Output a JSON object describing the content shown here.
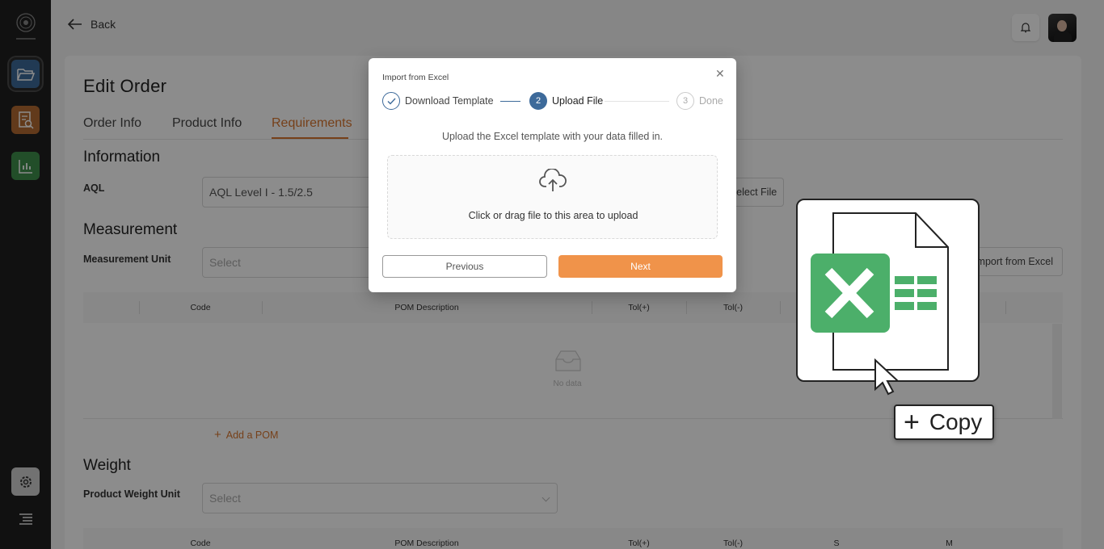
{
  "header": {
    "back_label": "Back"
  },
  "page": {
    "title": "Edit Order",
    "tabs": [
      {
        "label": "Order Info"
      },
      {
        "label": "Product Info"
      },
      {
        "label": "Requirements",
        "active": true
      }
    ]
  },
  "information": {
    "section_title": "Information",
    "aql_label": "AQL",
    "aql_value": "AQL Level I - 1.5/2.5",
    "select_file_label": "Select File"
  },
  "measurement": {
    "section_title": "Measurement",
    "unit_label": "Measurement Unit",
    "unit_placeholder": "Select",
    "import_button": "Import from Excel",
    "columns": [
      "Code",
      "POM Description",
      "Tol(+)",
      "Tol(-)"
    ],
    "empty_text": "No data",
    "add_pom": "Add a POM"
  },
  "weight": {
    "section_title": "Weight",
    "unit_label": "Product Weight Unit",
    "unit_placeholder": "Select",
    "columns": [
      "Code",
      "POM Description",
      "Tol(+)",
      "Tol(-)",
      "S",
      "M"
    ]
  },
  "modal": {
    "title": "Import from Excel",
    "steps": [
      {
        "label": "Download Template",
        "status": "done"
      },
      {
        "number": "2",
        "label": "Upload File",
        "status": "active"
      },
      {
        "number": "3",
        "label": "Done",
        "status": "pending"
      }
    ],
    "instruction": "Upload the Excel template with your data filled in.",
    "dropzone_text": "Click or drag file to this area to upload",
    "previous_label": "Previous",
    "next_label": "Next"
  },
  "drag_feedback": {
    "copy_label": "Copy"
  },
  "colors": {
    "accent": "#d8762f",
    "primary": "#3d6a9a",
    "next_button": "#f0934a",
    "excel_green": "#4caf6a",
    "sidebar": "#1f1f1f"
  }
}
